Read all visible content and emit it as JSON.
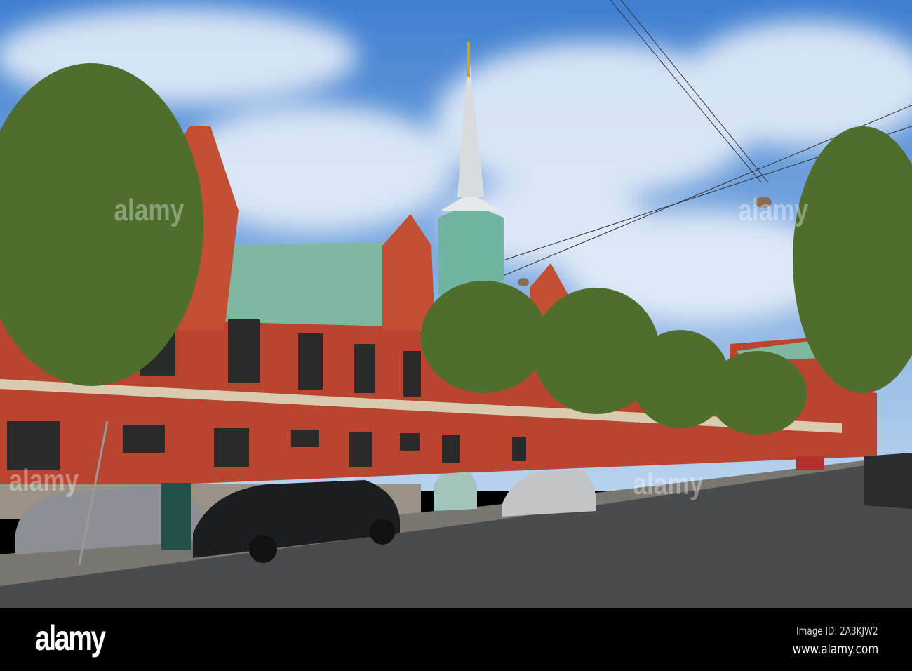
{
  "watermark": {
    "text": "alamy"
  },
  "footer": {
    "logo": "alamy",
    "image_id": "Image ID: 2A3KJW2",
    "url": "www.alamy.com"
  },
  "colors": {
    "sky_top": "#3f7fd0",
    "sky_bottom": "#a9c8ea",
    "brick": "#b8452f",
    "roof": "#7fb8a0",
    "road": "#4a4b4d",
    "tree": "#4f6e2c"
  }
}
